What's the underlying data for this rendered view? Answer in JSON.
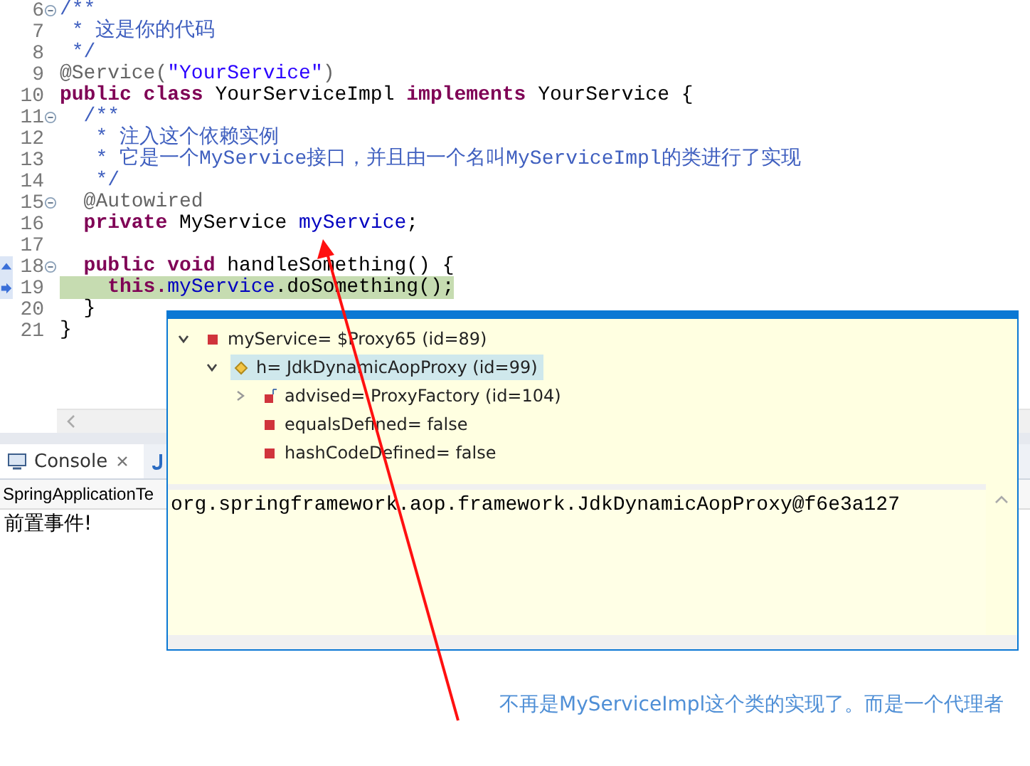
{
  "editor": {
    "lines": [
      {
        "number": "6",
        "fold": true,
        "tokens": [
          {
            "kind": "comment",
            "text": "/**"
          }
        ]
      },
      {
        "number": "7",
        "tokens": [
          {
            "kind": "comment",
            "text": " * 这是你的代码"
          }
        ]
      },
      {
        "number": "8",
        "tokens": [
          {
            "kind": "comment",
            "text": " */"
          }
        ]
      },
      {
        "number": "9",
        "tokens": [
          {
            "kind": "annotation",
            "text": "@Service("
          },
          {
            "kind": "string",
            "text": "\"YourService\""
          },
          {
            "kind": "annotation",
            "text": ")"
          }
        ]
      },
      {
        "number": "10",
        "tokens": [
          {
            "kind": "keyword",
            "text": "public class "
          },
          {
            "kind": "plain",
            "text": "YourServiceImpl "
          },
          {
            "kind": "keyword",
            "text": "implements "
          },
          {
            "kind": "plain",
            "text": "YourService {"
          }
        ]
      },
      {
        "number": "11",
        "fold": true,
        "tokens": [
          {
            "kind": "comment",
            "text": "  /**"
          }
        ]
      },
      {
        "number": "12",
        "tokens": [
          {
            "kind": "comment",
            "text": "   * 注入这个依赖实例"
          }
        ]
      },
      {
        "number": "13",
        "tokens": [
          {
            "kind": "comment",
            "text": "   * 它是一个MyService接口，并且由一个名叫MyServiceImpl的类进行了实现"
          }
        ]
      },
      {
        "number": "14",
        "tokens": [
          {
            "kind": "comment",
            "text": "   */"
          }
        ]
      },
      {
        "number": "15",
        "fold": true,
        "tokens": [
          {
            "kind": "annotation",
            "text": "  @Autowired"
          }
        ]
      },
      {
        "number": "16",
        "tokens": [
          {
            "kind": "keyword",
            "text": "  private "
          },
          {
            "kind": "plain",
            "text": "MyService "
          },
          {
            "kind": "field",
            "text": "myService"
          },
          {
            "kind": "plain",
            "text": ";"
          }
        ]
      },
      {
        "number": "17"
      },
      {
        "number": "18",
        "fold": true,
        "method_entry": true,
        "tokens": [
          {
            "kind": "keyword",
            "text": "  public void "
          },
          {
            "kind": "plain",
            "text": "handleSomething() {"
          }
        ]
      },
      {
        "number": "19",
        "current_line": true,
        "highlighted": true,
        "tokens": [
          {
            "kind": "keyword",
            "text": "    this."
          },
          {
            "kind": "field",
            "text": "myService"
          },
          {
            "kind": "plain",
            "text": ".doSomething();"
          }
        ]
      },
      {
        "number": "20",
        "tokens": [
          {
            "kind": "plain",
            "text": "  }"
          }
        ]
      },
      {
        "number": "21",
        "tokens": [
          {
            "kind": "plain",
            "text": "}"
          }
        ]
      }
    ]
  },
  "console": {
    "tabs": [
      {
        "label": "Console",
        "selected": true
      }
    ],
    "description": "SpringApplicationTe",
    "output": "前置事件!"
  },
  "inspector": {
    "tree": [
      {
        "kind": "field",
        "label": "myService= $Proxy65  (id=89)",
        "expanded": true,
        "selected": false,
        "children": [
          {
            "kind": "protected",
            "label": "h= JdkDynamicAopProxy  (id=99)",
            "expanded": true,
            "selected": true,
            "children": [
              {
                "kind": "final",
                "label": "advised= ProxyFactory  (id=104)",
                "expanded": false,
                "selected": false
              },
              {
                "kind": "field",
                "label": "equalsDefined= false",
                "selected": false
              },
              {
                "kind": "field",
                "label": "hashCodeDefined= false",
                "selected": false
              }
            ]
          }
        ]
      }
    ],
    "detail": "org.springframework.aop.framework.JdkDynamicAopProxy@f6e3a127"
  },
  "annotation": {
    "text": "不再是MyServiceImpl这个类的实现了。而是一个代理者"
  }
}
